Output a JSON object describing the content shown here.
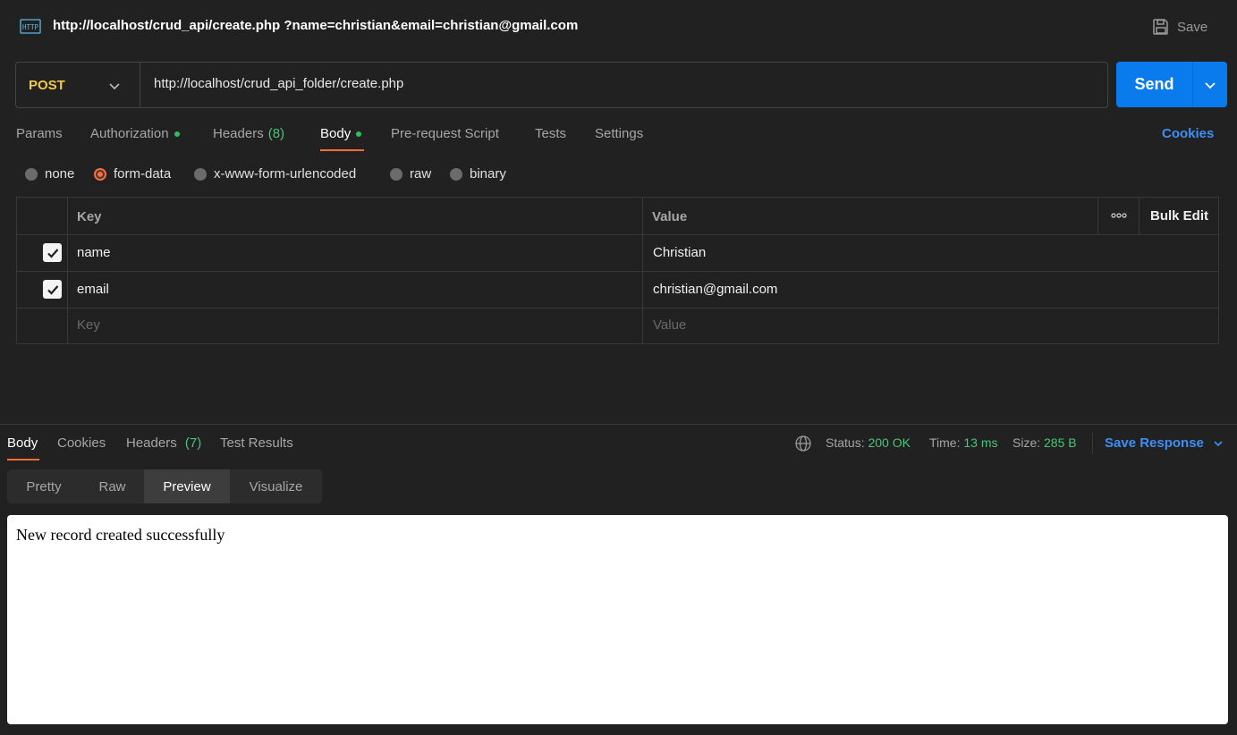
{
  "window": {
    "request_title": "http://localhost/crud_api/create.php ?name=christian&email=christian@gmail.com",
    "title_icon": "http-icon",
    "save_label": "Save",
    "save_icon": "floppy-disk-icon"
  },
  "request": {
    "method": "POST",
    "url": "http://localhost/crud_api_folder/create.php",
    "send_label": "Send"
  },
  "request_tabs": {
    "params": "Params",
    "authorization": "Authorization",
    "headers": "Headers",
    "headers_count": "(8)",
    "body": "Body",
    "pre_request": "Pre-request Script",
    "tests": "Tests",
    "settings": "Settings",
    "cookies": "Cookies",
    "active": "Body"
  },
  "body_types": {
    "none": "none",
    "form_data": "form-data",
    "urlencoded": "x-www-form-urlencoded",
    "raw": "raw",
    "binary": "binary",
    "selected": "form-data"
  },
  "form_table": {
    "key_header": "Key",
    "value_header": "Value",
    "bulk_edit": "Bulk Edit",
    "rows": [
      {
        "checked": true,
        "key": "name",
        "value": "Christian"
      },
      {
        "checked": true,
        "key": "email",
        "value": "christian@gmail.com"
      }
    ],
    "key_placeholder": "Key",
    "value_placeholder": "Value"
  },
  "response": {
    "tabs": {
      "body": "Body",
      "cookies": "Cookies",
      "headers": "Headers",
      "headers_count": "(7)",
      "test_results": "Test Results",
      "active": "Body"
    },
    "status_label": "Status:",
    "status_value": "200 OK",
    "time_label": "Time:",
    "time_value": "13 ms",
    "size_label": "Size:",
    "size_value": "285 B",
    "save_response": "Save Response",
    "views": {
      "pretty": "Pretty",
      "raw": "Raw",
      "preview": "Preview",
      "visualize": "Visualize",
      "active": "Preview"
    },
    "preview_text": "New record created successfully"
  },
  "colors": {
    "background": "#212121",
    "accent_orange": "#ff6c37",
    "send_blue": "#097bed",
    "link_blue": "#3e8ef7",
    "success_green": "#49c47a",
    "method_yellow": "#f2c94c"
  }
}
